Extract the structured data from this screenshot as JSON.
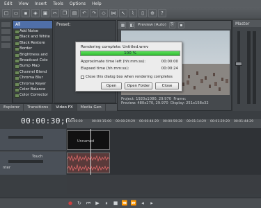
{
  "menu": [
    "Edit",
    "View",
    "Insert",
    "Tools",
    "Options",
    "Help"
  ],
  "fx_tree": {
    "header": "All",
    "items": [
      "Add Noise",
      "Black and White",
      "Black Restore",
      "Border",
      "Brightness and",
      "Broadcast Colo",
      "Bump Map",
      "Channel Blend",
      "Chroma Blur",
      "Chroma Keyer",
      "Color Balance",
      "Color Corrector"
    ]
  },
  "preset_pane": {
    "header": "Preset:"
  },
  "preview": {
    "mode": "Preview (Auto)",
    "project_label": "Project:",
    "project_val": "1920x1080, 29.970",
    "preview_label": "Preview:",
    "preview_val": "480x270, 29.970",
    "frame_label": "Frame:",
    "display_label": "Display:",
    "display_val": "251x158x32"
  },
  "master": {
    "header": "Master"
  },
  "upper_tabs": [
    "Explorer",
    "Transitions",
    "Video FX",
    "Media Gen"
  ],
  "timeline": {
    "timecode": "00:00:30;00",
    "ruler": [
      "00:00:00",
      "00:00:15:00",
      "00:00:29:29",
      "00:00:44:29",
      "00:00:59:28",
      "00:01:14:29",
      "00:01:29:29",
      "00:01:44:29"
    ],
    "video_clip_label": "Unnamed",
    "audio_label": "Touch",
    "track_label": "nter"
  },
  "dialog": {
    "title": "Rendering complete: Untitled.wmv",
    "progress_text": "100 %",
    "progress": 1.0,
    "approx_label": "Approximate time left (hh:mm:ss):",
    "approx_val": "00:00:00",
    "elapsed_label": "Elapsed time (hh:mm:ss):",
    "elapsed_val": "00:00:24",
    "close_check": "Close this dialog box when rendering completes",
    "btn_open": "Open",
    "btn_open_folder": "Open Folder",
    "btn_close": "Close"
  },
  "colors": {
    "bg": "#4a4e52",
    "progress": "#2fb82f",
    "audio_wave": "#c04040"
  }
}
